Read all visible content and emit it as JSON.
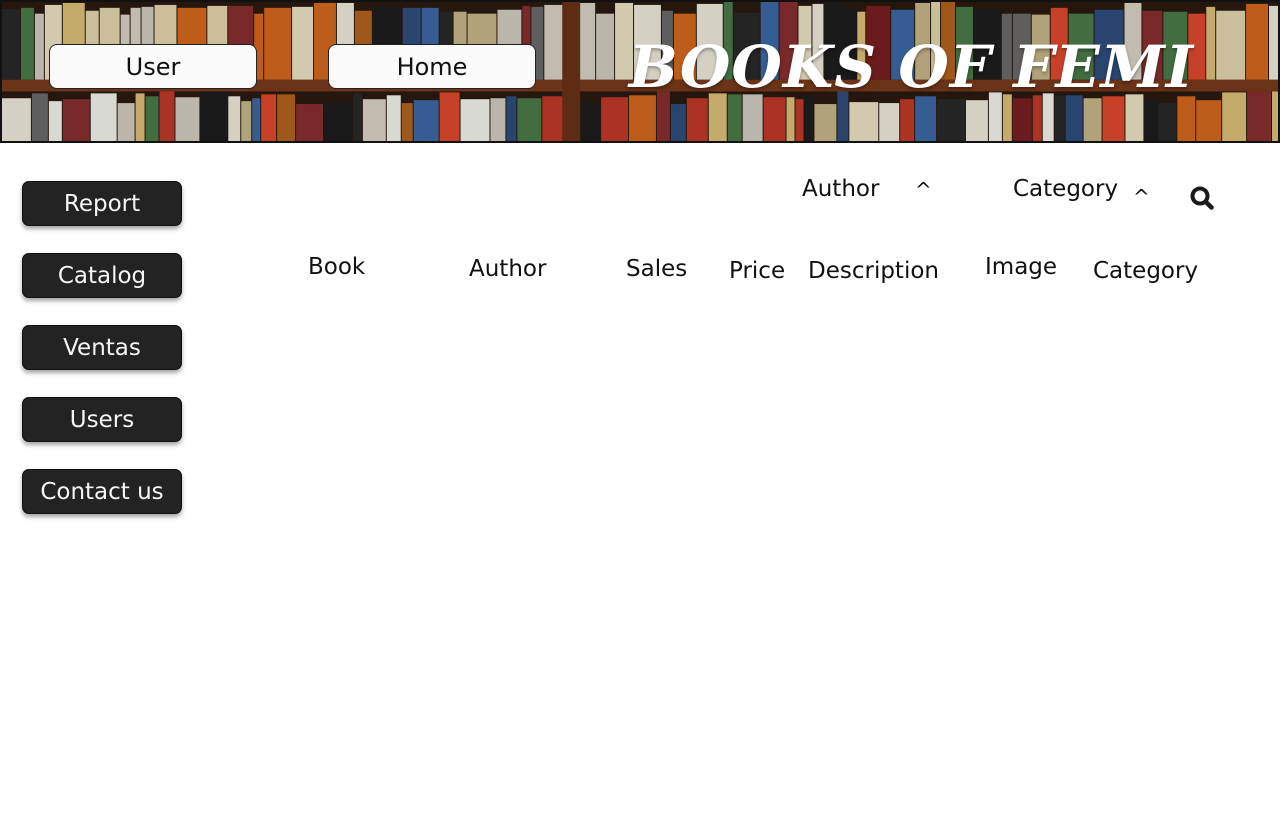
{
  "header": {
    "brand": "BOOKS OF FEMI",
    "user_label": "User",
    "home_label": "Home"
  },
  "sidebar": {
    "items": [
      {
        "label": "Report"
      },
      {
        "label": "Catalog"
      },
      {
        "label": "Ventas"
      },
      {
        "label": "Users"
      },
      {
        "label": "Contact us"
      }
    ]
  },
  "filters": {
    "author_label": "Author",
    "category_label": "Category",
    "caret": "^"
  },
  "table": {
    "columns": [
      "Book",
      "Author",
      "Sales",
      "Price",
      "Description",
      "Image",
      "Category"
    ],
    "rows": []
  },
  "icons": {
    "search": "search-icon",
    "caret": "caret-up-icon"
  },
  "colors": {
    "sidebar_button_bg": "#232323",
    "sidebar_button_text": "#f5f5f5",
    "top_button_bg": "#fbfbfb",
    "brand_text": "#ffffff"
  }
}
